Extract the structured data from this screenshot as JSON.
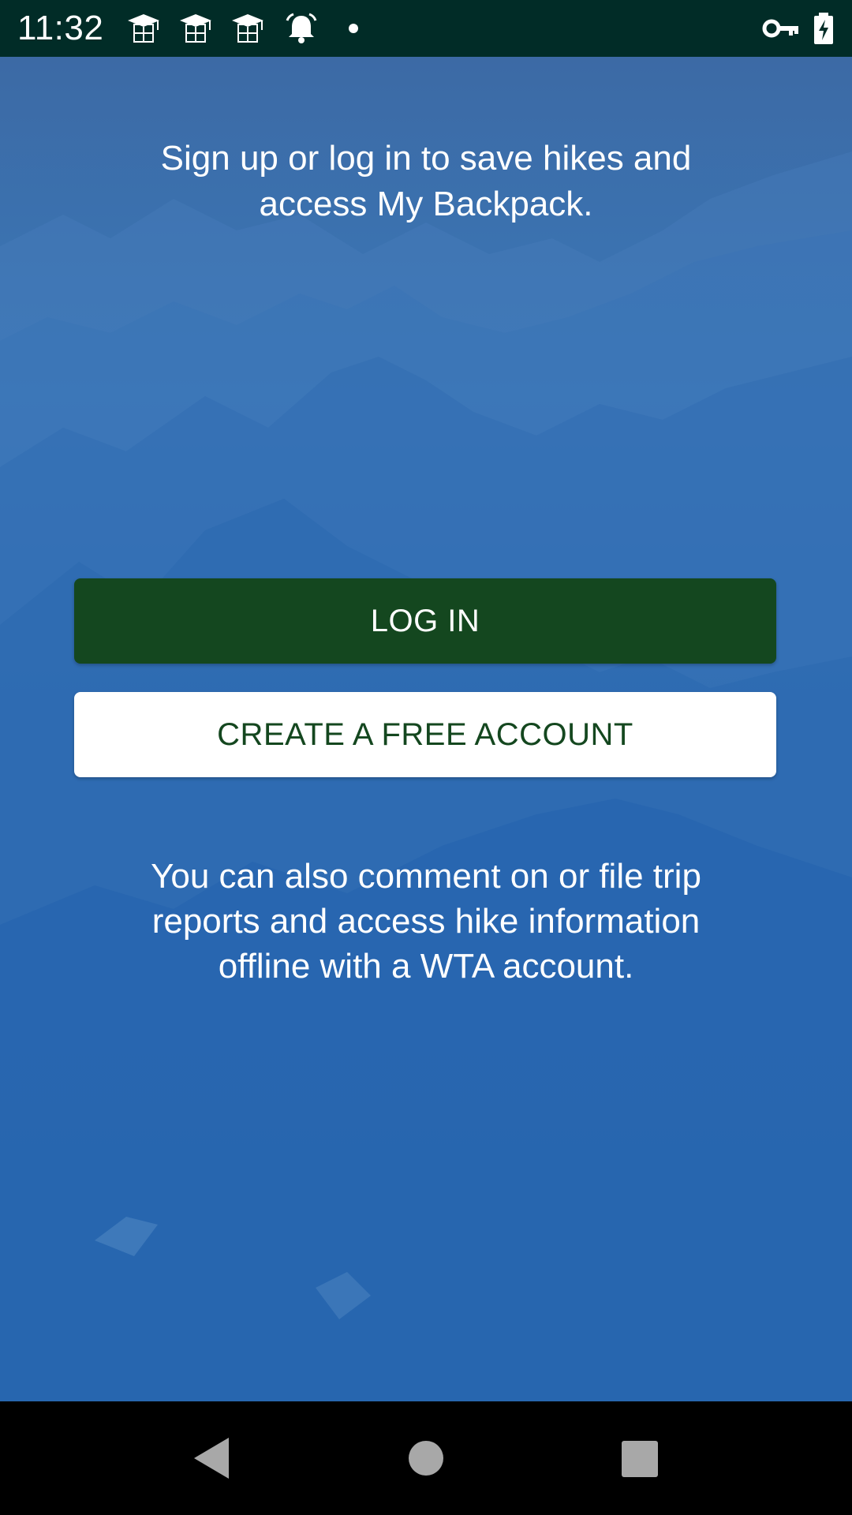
{
  "status_bar": {
    "time": "11:32",
    "icons": [
      "graduation-cap-icon",
      "graduation-cap-icon",
      "graduation-cap-icon",
      "alarm-bell-icon",
      "dot-icon",
      "key-icon",
      "battery-charging-icon"
    ]
  },
  "main": {
    "intro_line1": "Sign up or log in to save hikes and",
    "intro_line2": "access My Backpack.",
    "login_label": "LOG IN",
    "create_account_label": "CREATE A FREE ACCOUNT",
    "note_line1": "You can also comment on or file trip",
    "note_line2": "reports and access hike information",
    "note_line3": "offline with a WTA account."
  },
  "nav_bar": {
    "icons": [
      "back-icon",
      "home-icon",
      "recents-icon"
    ]
  },
  "colors": {
    "status_bar_bg": "#012c27",
    "primary_green": "#14471f",
    "background_blue": "#2469b2"
  }
}
